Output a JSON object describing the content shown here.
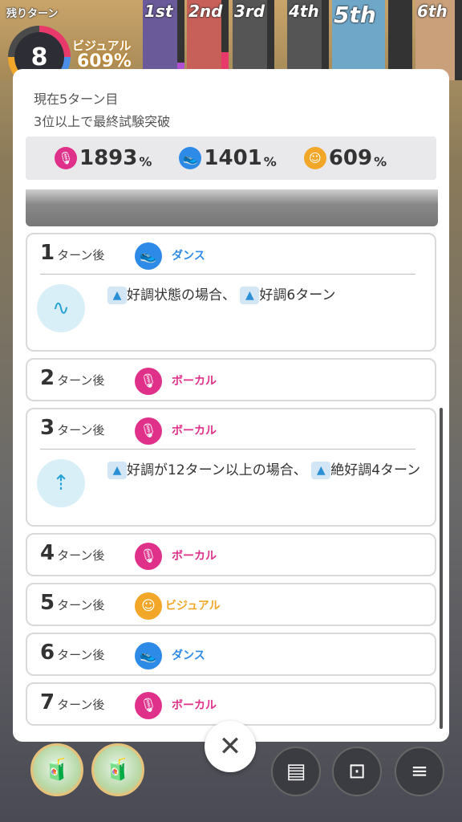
{
  "hud": {
    "remaining_turns_label": "残りターン",
    "remaining_turns": "8",
    "visual_label": "ビジュアル",
    "visual_percent": "609%",
    "ranks": [
      {
        "label": "1st",
        "fill": 0.22,
        "color": "#b050d0",
        "portrait": "#6a5a9a"
      },
      {
        "label": "2nd",
        "fill": 0.35,
        "color": "#e83a6a",
        "portrait": "#c8605a"
      },
      {
        "label": "3rd",
        "fill": 0.0,
        "color": "#aaaaaa",
        "portrait": "#555555"
      },
      {
        "label": "4th",
        "fill": 0.0,
        "color": "#aaaaaa",
        "portrait": "#555555"
      },
      {
        "label": "5th",
        "fill": 0.0,
        "color": "#4a8ee8",
        "portrait": "#6fa7c9"
      },
      {
        "label": "6th",
        "fill": 0.0,
        "color": "#aaaaaa",
        "portrait": "#c9a07a"
      }
    ]
  },
  "panel": {
    "status_turn": "現在5ターン目",
    "status_goal": "3位以上で最終試験突破",
    "stats": [
      {
        "icon": "vocal-mic-icon",
        "color": "#e0318a",
        "glyph": "🎙",
        "value": "1893",
        "unit": "%"
      },
      {
        "icon": "dance-shoe-icon",
        "color": "#2d8ae6",
        "glyph": "👟",
        "value": "1401",
        "unit": "%"
      },
      {
        "icon": "visual-face-icon",
        "color": "#f2a728",
        "glyph": "☺",
        "value": "609",
        "unit": "%"
      }
    ],
    "turn_suffix": "ターン後",
    "cards": [
      {
        "turn": "1",
        "type": "ダンス",
        "type_color": "#2d8ae6",
        "type_icon": "dance-shoe-icon",
        "glyph": "👟",
        "effect_icon": "condition-wave-icon",
        "effect_parts": [
          "好調",
          "状態の場合、",
          "好調",
          "6ターン"
        ]
      },
      {
        "turn": "2",
        "type": "ボーカル",
        "type_color": "#e0318a",
        "type_icon": "vocal-mic-icon",
        "glyph": "🎙"
      },
      {
        "turn": "3",
        "type": "ボーカル",
        "type_color": "#e0318a",
        "type_icon": "vocal-mic-icon",
        "glyph": "🎙",
        "effect_icon": "condition-up-icon",
        "effect_parts": [
          "好調",
          "が12ターン以上の場合、",
          "絶好調",
          "4ターン"
        ]
      },
      {
        "turn": "4",
        "type": "ボーカル",
        "type_color": "#e0318a",
        "type_icon": "vocal-mic-icon",
        "glyph": "🎙"
      },
      {
        "turn": "5",
        "type": "ビジュアル",
        "type_color": "#f2a728",
        "type_icon": "visual-face-icon",
        "glyph": "☺"
      },
      {
        "turn": "6",
        "type": "ダンス",
        "type_color": "#2d8ae6",
        "type_icon": "dance-shoe-icon",
        "glyph": "👟"
      },
      {
        "turn": "7",
        "type": "ボーカル",
        "type_color": "#e0318a",
        "type_icon": "vocal-mic-icon",
        "glyph": "🎙"
      }
    ]
  },
  "bottom": {
    "close_glyph": "✕",
    "items": [
      "drink-bottle-icon",
      "drink-bottle-icon"
    ],
    "buttons": [
      "memo-icon",
      "unlock-box-icon",
      "menu-icon"
    ]
  }
}
